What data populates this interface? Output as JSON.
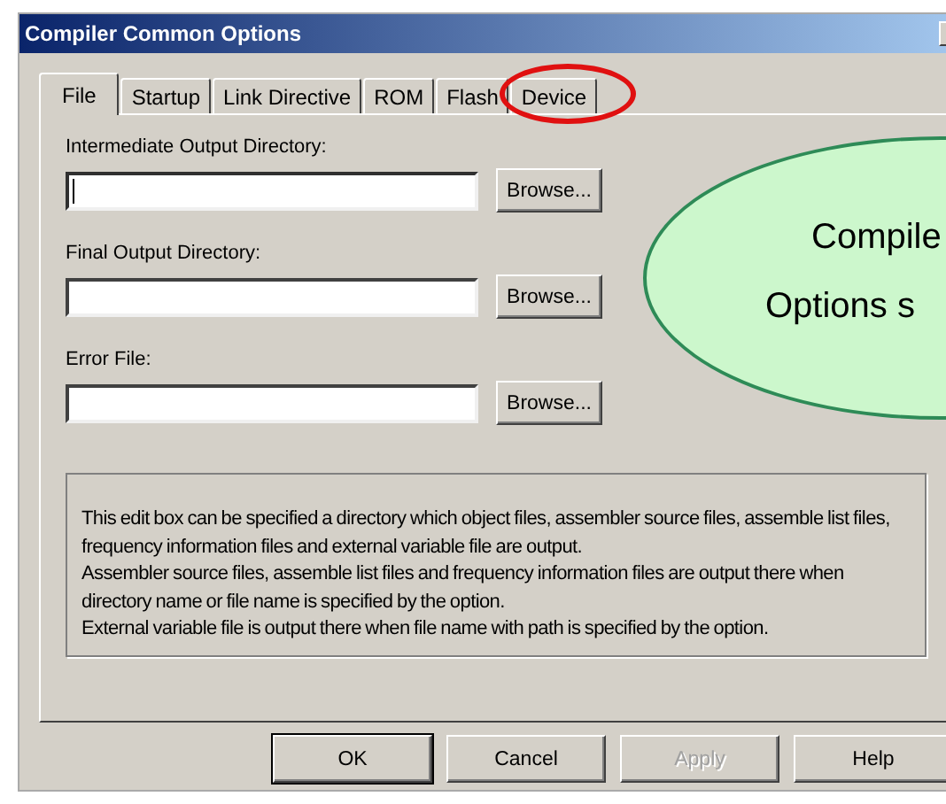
{
  "window": {
    "title": "Compiler Common Options"
  },
  "tabs": [
    {
      "label": "File",
      "selected": true,
      "highlighted": false
    },
    {
      "label": "Startup",
      "selected": false,
      "highlighted": false
    },
    {
      "label": "Link Directive",
      "selected": false,
      "highlighted": false
    },
    {
      "label": "ROM",
      "selected": false,
      "highlighted": false
    },
    {
      "label": "Flash",
      "selected": false,
      "highlighted": false
    },
    {
      "label": "Device",
      "selected": false,
      "highlighted": true
    }
  ],
  "fields": [
    {
      "label": "Intermediate Output Directory:",
      "focused": true,
      "button": "Browse..."
    },
    {
      "label": "Final Output Directory:",
      "focused": false,
      "button": "Browse..."
    },
    {
      "label": "Error File:",
      "focused": false,
      "button": "Browse..."
    }
  ],
  "description": [
    "This edit box can be specified a directory which object files, assembler source files, assemble list files, frequency information files and external variable file are output.",
    "Assembler source files, assemble list files and frequency information files are output there when directory name or file name is specified by the option.",
    "External variable file is output there when file name with path is specified by the option."
  ],
  "buttons": [
    {
      "label": "OK",
      "default": true,
      "disabled": false
    },
    {
      "label": "Cancel",
      "default": false,
      "disabled": false
    },
    {
      "label": "Apply",
      "default": false,
      "disabled": true
    },
    {
      "label": "Help",
      "default": false,
      "disabled": false
    }
  ],
  "callout": {
    "lines": [
      "Compile",
      "Options s"
    ]
  }
}
